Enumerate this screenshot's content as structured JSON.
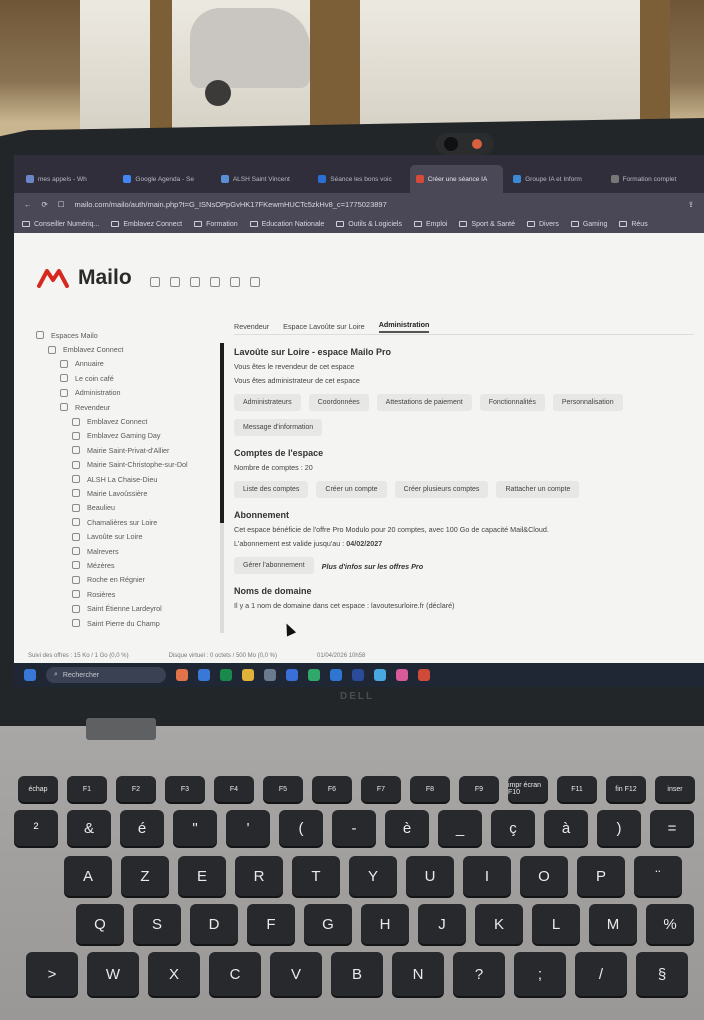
{
  "browser": {
    "tabs": [
      {
        "label": "mes appels - Wh",
        "color": "#6a86c9"
      },
      {
        "label": "Google Agenda - Se",
        "color": "#4285f4"
      },
      {
        "label": "ALSH Saint Vincent",
        "color": "#5b8ed6"
      },
      {
        "label": "Séance les bons voic",
        "color": "#2b6fd6"
      },
      {
        "label": "Créer une séance IA",
        "color": "#d64a3a"
      },
      {
        "label": "Groupe IA et Inform",
        "color": "#3c8ad6"
      },
      {
        "label": "Formation complet",
        "color": "#777"
      }
    ],
    "url": "mailo.com/mailo/auth/main.php?t=G_ISNsOPpGvHK17FKewmHUCTc5zkHv8_c=1775023897",
    "bookmarks": [
      "Conseiller Numériq...",
      "Emblavez Connect",
      "Formation",
      "Education Nationale",
      "Outils & Logiciels",
      "Emploi",
      "Sport & Santé",
      "Divers",
      "Gaming",
      "Réus"
    ]
  },
  "app": {
    "brand": "Mailo",
    "sidebar": {
      "items": [
        {
          "label": "Espaces Mailo",
          "indent": 0
        },
        {
          "label": "Emblavez Connect",
          "indent": 1
        },
        {
          "label": "Annuaire",
          "indent": 2
        },
        {
          "label": "Le coin café",
          "indent": 2
        },
        {
          "label": "Administration",
          "indent": 2
        },
        {
          "label": "Revendeur",
          "indent": 2
        },
        {
          "label": "Emblavez Connect",
          "indent": 3
        },
        {
          "label": "Emblavez Gaming Day",
          "indent": 3
        },
        {
          "label": "Mairie Saint-Privat-d'Allier",
          "indent": 3
        },
        {
          "label": "Mairie Saint-Christophe-sur-Dol",
          "indent": 3
        },
        {
          "label": "ALSH La Chaise-Dieu",
          "indent": 3
        },
        {
          "label": "Mairie Lavoûssière",
          "indent": 3
        },
        {
          "label": "Beaulieu",
          "indent": 3
        },
        {
          "label": "Chamalières sur Loire",
          "indent": 3
        },
        {
          "label": "Lavoûte sur Loire",
          "indent": 3
        },
        {
          "label": "Malrevers",
          "indent": 3
        },
        {
          "label": "Mézères",
          "indent": 3
        },
        {
          "label": "Roche en Régnier",
          "indent": 3
        },
        {
          "label": "Rosières",
          "indent": 3
        },
        {
          "label": "Saint Étienne Lardeyrol",
          "indent": 3
        },
        {
          "label": "Saint Pierre du Champ",
          "indent": 3
        }
      ]
    },
    "breadcrumb": [
      "Revendeur",
      "Espace Lavoûte sur Loire",
      "Administration"
    ],
    "space": {
      "title": "Lavoûte sur Loire - espace Mailo Pro",
      "line1": "Vous êtes le revendeur de cet espace",
      "line2": "Vous êtes administrateur de cet espace",
      "buttons": [
        "Administrateurs",
        "Coordonnées",
        "Attestations de paiement",
        "Fonctionnalités",
        "Personnalisation",
        "Message d'information"
      ]
    },
    "accounts": {
      "title": "Comptes de l'espace",
      "count_label": "Nombre de comptes : 20",
      "buttons": [
        "Liste des comptes",
        "Créer un compte",
        "Créer plusieurs comptes",
        "Rattacher un compte"
      ]
    },
    "subscription": {
      "title": "Abonnement",
      "line1": "Cet espace bénéficie de l'offre Pro Modulo pour 20 comptes, avec 100 Go de capacité Mail&Cloud.",
      "line2_prefix": "L'abonnement est valide jusqu'au :",
      "valid_until": "04/02/2027",
      "manage_label": "Gérer l'abonnement",
      "more_link": "Plus d'infos sur les offres Pro"
    },
    "domains": {
      "title": "Noms de domaine",
      "line1": "Il y a 1 nom de domaine dans cet espace : lavoutesurloire.fr (déclaré)"
    },
    "status": {
      "left": "Suivi des offres : 15 Ko / 1 Go (0,0 %)",
      "middle": "Disque virtuel : 0 octets / 500 Mo (0,0 %)",
      "right": "01/04/2026 10h58"
    }
  },
  "taskbar": {
    "search_label": "Rechercher",
    "icons": [
      "#e0734a",
      "#3a78d8",
      "#1a8a4a",
      "#e0b23a",
      "#6b7a8f",
      "#3a6fd8",
      "#2fa86a",
      "#2f76d2",
      "#2a4a9a",
      "#4aa8e0",
      "#d85a9a",
      "#d04a3a"
    ]
  },
  "keyboard": {
    "fn_row": [
      "échap",
      "F1",
      "F2",
      "F3",
      "F4",
      "F5",
      "F6",
      "F7",
      "F8",
      "F9",
      "impr écran F10",
      "F11",
      "fin F12",
      "inser"
    ],
    "num_row": [
      "²",
      "&",
      "é",
      "\"",
      "'",
      "(",
      "-",
      "è",
      "_",
      "ç",
      "à",
      ")",
      "="
    ],
    "row_a": [
      "A",
      "Z",
      "E",
      "R",
      "T",
      "Y",
      "U",
      "I",
      "O",
      "P",
      "¨"
    ],
    "row_q": [
      "Q",
      "S",
      "D",
      "F",
      "G",
      "H",
      "J",
      "K",
      "L",
      "M",
      "%"
    ],
    "row_w": [
      ">",
      "W",
      "X",
      "C",
      "V",
      "B",
      "N",
      "?",
      ";",
      "/",
      "§"
    ]
  },
  "laptop_brand": "DELL"
}
